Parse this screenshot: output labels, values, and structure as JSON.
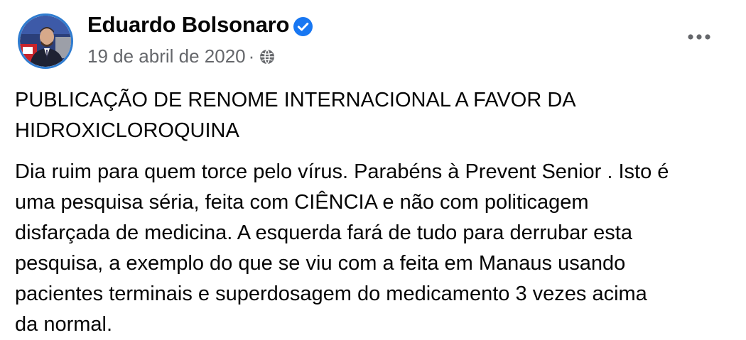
{
  "post": {
    "author": "Eduardo Bolsonaro",
    "verified_icon": "verified-badge-icon",
    "date": "19 de abril de 2020",
    "separator": "·",
    "privacy_icon": "globe-icon",
    "menu_icon": "more-horizontal-icon",
    "headline": "PUBLICAÇÃO DE RENOME INTERNACIONAL A FAVOR DA\nHIDROXICLOROQUINA",
    "body": "Dia ruim para quem torce pelo vírus. Parabéns à Prevent Senior . Isto é\numa pesquisa séria, feita com CIÊNCIA e não com politicagem\ndisfarçada de medicina. A esquerda fará de tudo para derrubar esta\npesquisa, a exemplo do que se viu com a feita em Manaus usando\npacientes terminais e superdosagem do medicamento 3 vezes acima\nda normal."
  },
  "colors": {
    "text": "#050505",
    "secondary": "#65676b",
    "verified": "#1877f2",
    "avatar_ring": "#2f7cd0"
  }
}
